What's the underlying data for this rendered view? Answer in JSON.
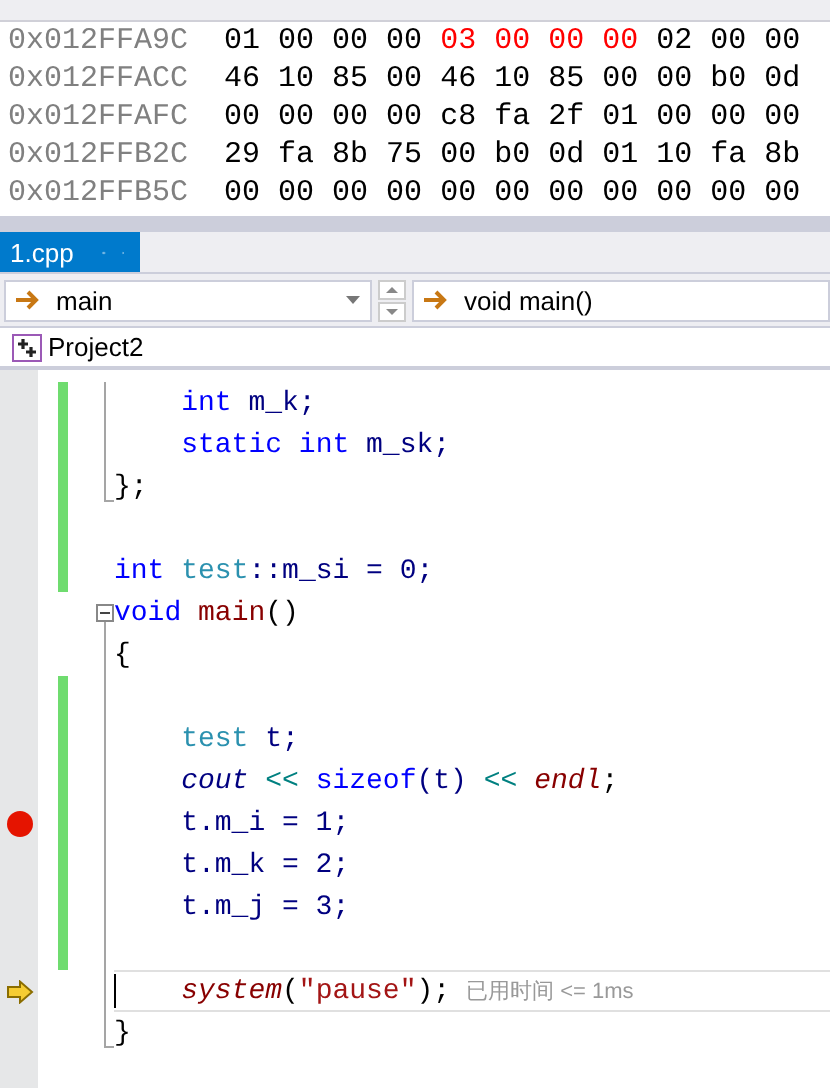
{
  "memory": {
    "rows": [
      {
        "address": "0x012FFA9C",
        "bytes": [
          {
            "value": "01",
            "changed": false
          },
          {
            "value": "00",
            "changed": false
          },
          {
            "value": "00",
            "changed": false
          },
          {
            "value": "00",
            "changed": false
          },
          {
            "value": "03",
            "changed": true
          },
          {
            "value": "00",
            "changed": true
          },
          {
            "value": "00",
            "changed": true
          },
          {
            "value": "00",
            "changed": true
          },
          {
            "value": "02",
            "changed": false
          },
          {
            "value": "00",
            "changed": false
          },
          {
            "value": "00",
            "changed": false
          }
        ]
      },
      {
        "address": "0x012FFACC",
        "bytes": [
          {
            "value": "46",
            "changed": false
          },
          {
            "value": "10",
            "changed": false
          },
          {
            "value": "85",
            "changed": false
          },
          {
            "value": "00",
            "changed": false
          },
          {
            "value": "46",
            "changed": false
          },
          {
            "value": "10",
            "changed": false
          },
          {
            "value": "85",
            "changed": false
          },
          {
            "value": "00",
            "changed": false
          },
          {
            "value": "00",
            "changed": false
          },
          {
            "value": "b0",
            "changed": false
          },
          {
            "value": "0d",
            "changed": false
          }
        ]
      },
      {
        "address": "0x012FFAFC",
        "bytes": [
          {
            "value": "00",
            "changed": false
          },
          {
            "value": "00",
            "changed": false
          },
          {
            "value": "00",
            "changed": false
          },
          {
            "value": "00",
            "changed": false
          },
          {
            "value": "c8",
            "changed": false
          },
          {
            "value": "fa",
            "changed": false
          },
          {
            "value": "2f",
            "changed": false
          },
          {
            "value": "01",
            "changed": false
          },
          {
            "value": "00",
            "changed": false
          },
          {
            "value": "00",
            "changed": false
          },
          {
            "value": "00",
            "changed": false
          }
        ]
      },
      {
        "address": "0x012FFB2C",
        "bytes": [
          {
            "value": "29",
            "changed": false
          },
          {
            "value": "fa",
            "changed": false
          },
          {
            "value": "8b",
            "changed": false
          },
          {
            "value": "75",
            "changed": false
          },
          {
            "value": "00",
            "changed": false
          },
          {
            "value": "b0",
            "changed": false
          },
          {
            "value": "0d",
            "changed": false
          },
          {
            "value": "01",
            "changed": false
          },
          {
            "value": "10",
            "changed": false
          },
          {
            "value": "fa",
            "changed": false
          },
          {
            "value": "8b",
            "changed": false
          }
        ]
      },
      {
        "address": "0x012FFB5C",
        "bytes": [
          {
            "value": "00",
            "changed": false
          },
          {
            "value": "00",
            "changed": false
          },
          {
            "value": "00",
            "changed": false
          },
          {
            "value": "00",
            "changed": false
          },
          {
            "value": "00",
            "changed": false
          },
          {
            "value": "00",
            "changed": false
          },
          {
            "value": "00",
            "changed": false
          },
          {
            "value": "00",
            "changed": false
          },
          {
            "value": "00",
            "changed": false
          },
          {
            "value": "00",
            "changed": false
          },
          {
            "value": "00",
            "changed": false
          }
        ]
      }
    ]
  },
  "tab": {
    "label": "1.cpp",
    "selected": true
  },
  "navigation": {
    "scope": "main",
    "member": "void main()"
  },
  "project": "Project2",
  "lines": [
    {
      "kind": "guide",
      "changed": true,
      "breakpoint": false,
      "current": false,
      "indented": true,
      "tokens": [
        {
          "t": "int",
          "kind": "keyword"
        },
        {
          "t": " m_k;",
          "kind": "member"
        }
      ]
    },
    {
      "kind": "guide",
      "changed": true,
      "breakpoint": false,
      "current": false,
      "indented": true,
      "tokens": [
        {
          "t": "static",
          "kind": "keyword"
        },
        {
          "t": " int",
          "kind": "keyword"
        },
        {
          "t": " m_sk;",
          "kind": "member"
        }
      ]
    },
    {
      "kind": "guide-end",
      "changed": true,
      "breakpoint": false,
      "current": false,
      "indented": false,
      "tokens": [
        {
          "t": "};",
          "kind": "plain"
        }
      ]
    },
    {
      "kind": "plain",
      "changed": true,
      "breakpoint": false,
      "current": false,
      "indented": false
    },
    {
      "kind": "plain",
      "changed": true,
      "breakpoint": false,
      "current": false,
      "indented": false,
      "tokens": [
        {
          "t": "int",
          "kind": "keyword"
        },
        {
          "t": " test",
          "kind": "type"
        },
        {
          "t": "::m_si = 0;",
          "kind": "member"
        }
      ]
    },
    {
      "kind": "fold",
      "expanded": true,
      "changed": false,
      "breakpoint": false,
      "current": false,
      "indented": false,
      "tokens": [
        {
          "t": "void",
          "kind": "keyword"
        },
        {
          "t": " main",
          "kind": "function"
        },
        {
          "t": "()",
          "kind": "plain"
        }
      ]
    },
    {
      "kind": "guide",
      "changed": false,
      "breakpoint": false,
      "current": false,
      "indented": false,
      "tokens": [
        {
          "t": "{",
          "kind": "plain"
        }
      ]
    },
    {
      "kind": "guide",
      "changed": true,
      "breakpoint": false,
      "current": false,
      "indented": false
    },
    {
      "kind": "guide",
      "changed": true,
      "breakpoint": false,
      "current": false,
      "indented": true,
      "tokens": [
        {
          "t": "test",
          "kind": "type"
        },
        {
          "t": " t;",
          "kind": "member"
        }
      ]
    },
    {
      "kind": "guide",
      "changed": true,
      "breakpoint": false,
      "current": false,
      "indented": true,
      "tokens": [
        {
          "t": "cout",
          "kind": "global"
        },
        {
          "t": " <<",
          "kind": "operator"
        },
        {
          "t": " sizeof",
          "kind": "keyword"
        },
        {
          "t": "(t)",
          "kind": "member"
        },
        {
          "t": " <<",
          "kind": "operator"
        },
        {
          "t": " endl",
          "kind": "call"
        },
        {
          "t": ";",
          "kind": "plain"
        }
      ]
    },
    {
      "kind": "guide",
      "changed": true,
      "breakpoint": true,
      "current": false,
      "indented": true,
      "tokens": [
        {
          "t": "t.m_i = 1;",
          "kind": "member"
        }
      ]
    },
    {
      "kind": "guide",
      "changed": true,
      "breakpoint": false,
      "current": false,
      "indented": true,
      "tokens": [
        {
          "t": "t.m_k = 2;",
          "kind": "member"
        }
      ]
    },
    {
      "kind": "guide",
      "changed": true,
      "breakpoint": false,
      "current": false,
      "indented": true,
      "tokens": [
        {
          "t": "t.m_j = 3;",
          "kind": "member"
        }
      ]
    },
    {
      "kind": "guide",
      "changed": true,
      "breakpoint": false,
      "current": false,
      "indented": false
    },
    {
      "kind": "guide",
      "changed": false,
      "breakpoint": false,
      "current": true,
      "indented": true,
      "tokens": [
        {
          "t": "system",
          "kind": "call"
        },
        {
          "t": "(",
          "kind": "plain"
        },
        {
          "t": "\"pause\"",
          "kind": "string"
        },
        {
          "t": ");",
          "kind": "plain"
        }
      ],
      "hint": "已用时间 <= 1ms"
    },
    {
      "kind": "guide-end",
      "changed": false,
      "breakpoint": false,
      "current": false,
      "indented": false,
      "tokens": [
        {
          "t": "}",
          "kind": "plain"
        }
      ]
    }
  ]
}
